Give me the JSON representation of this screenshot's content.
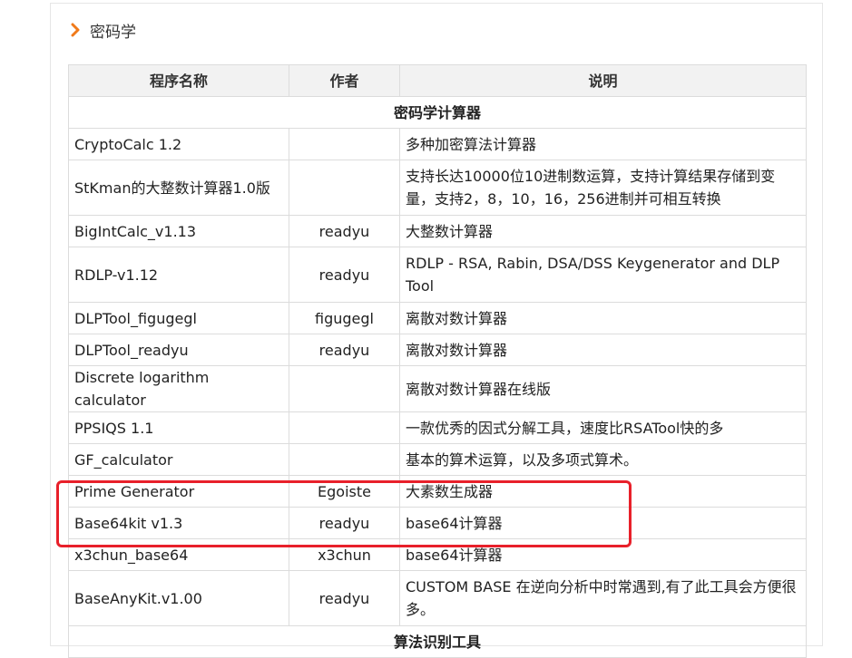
{
  "section": {
    "title": "密码学"
  },
  "table": {
    "headers": [
      "程序名称",
      "作者",
      "说明"
    ],
    "categories": [
      "密码学计算器",
      "算法识别工具"
    ],
    "rows": [
      {
        "name": "CryptoCalc 1.2",
        "author": "",
        "desc": "多种加密算法计算器"
      },
      {
        "name": "StKman的大整数计算器1.0版",
        "author": "",
        "desc": "支持长达10000位10进制数运算，支持计算结果存储到变量，支持2，8，10，16，256进制并可相互转换"
      },
      {
        "name": "BigIntCalc_v1.13",
        "author": "readyu",
        "desc": "大整数计算器"
      },
      {
        "name": "RDLP-v1.12",
        "author": "readyu",
        "desc": "RDLP - RSA, Rabin, DSA/DSS Keygenerator and DLP Tool"
      },
      {
        "name": "DLPTool_figugegl",
        "author": "figugegl",
        "desc": "离散对数计算器"
      },
      {
        "name": "DLPTool_readyu",
        "author": "readyu",
        "desc": "离散对数计算器"
      },
      {
        "name": "Discrete logarithm calculator",
        "author": "",
        "desc": "离散对数计算器在线版"
      },
      {
        "name": "PPSIQS 1.1",
        "author": "",
        "desc": "一款优秀的因式分解工具，速度比RSATool快的多"
      },
      {
        "name": "GF_calculator",
        "author": "",
        "desc": "基本的算术运算，以及多项式算术。"
      },
      {
        "name": "Prime Generator",
        "author": "Egoiste",
        "desc": "大素数生成器"
      },
      {
        "name": "Base64kit v1.3",
        "author": "readyu",
        "desc": "base64计算器"
      },
      {
        "name": "x3chun_base64",
        "author": "x3chun",
        "desc": "base64计算器"
      },
      {
        "name": "BaseAnyKit.v1.00",
        "author": "readyu",
        "desc": "CUSTOM BASE 在逆向分析中时常遇到,有了此工具会方便很多。"
      }
    ]
  },
  "colors": {
    "accent": "#f07a1a",
    "highlight": "#e8202a"
  }
}
